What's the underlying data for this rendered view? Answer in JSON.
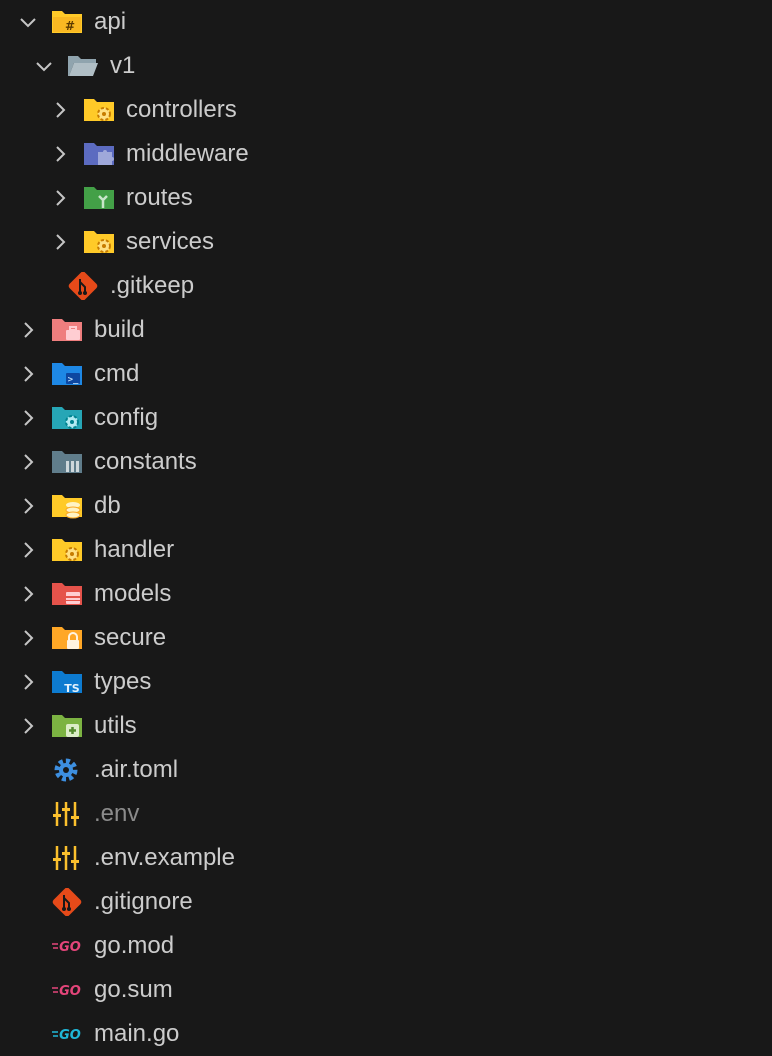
{
  "explorer": {
    "items": [
      {
        "label": "api",
        "icon": "folder-api-icon",
        "expanded": true
      },
      {
        "label": "v1",
        "icon": "folder-open-icon",
        "expanded": true
      },
      {
        "label": "controllers",
        "icon": "folder-controllers-icon",
        "expanded": false
      },
      {
        "label": "middleware",
        "icon": "folder-middleware-icon",
        "expanded": false
      },
      {
        "label": "routes",
        "icon": "folder-routes-icon",
        "expanded": false
      },
      {
        "label": "services",
        "icon": "folder-services-icon",
        "expanded": false
      },
      {
        "label": ".gitkeep",
        "icon": "git-icon"
      },
      {
        "label": "build",
        "icon": "folder-build-icon",
        "expanded": false
      },
      {
        "label": "cmd",
        "icon": "folder-cmd-icon",
        "expanded": false
      },
      {
        "label": "config",
        "icon": "folder-config-icon",
        "expanded": false
      },
      {
        "label": "constants",
        "icon": "folder-constants-icon",
        "expanded": false
      },
      {
        "label": "db",
        "icon": "folder-db-icon",
        "expanded": false
      },
      {
        "label": "handler",
        "icon": "folder-handler-icon",
        "expanded": false
      },
      {
        "label": "models",
        "icon": "folder-models-icon",
        "expanded": false
      },
      {
        "label": "secure",
        "icon": "folder-secure-icon",
        "expanded": false
      },
      {
        "label": "types",
        "icon": "folder-types-icon",
        "expanded": false,
        "badge": "TS"
      },
      {
        "label": "utils",
        "icon": "folder-utils-icon",
        "expanded": false
      },
      {
        "label": ".air.toml",
        "icon": "gear-icon"
      },
      {
        "label": ".env",
        "icon": "env-icon",
        "dimmed": true
      },
      {
        "label": ".env.example",
        "icon": "env-icon"
      },
      {
        "label": ".gitignore",
        "icon": "git-icon"
      },
      {
        "label": "go.mod",
        "icon": "go-mod-icon",
        "badge": "GO"
      },
      {
        "label": "go.sum",
        "icon": "go-mod-icon",
        "badge": "GO"
      },
      {
        "label": "main.go",
        "icon": "go-file-icon",
        "badge": "GO"
      }
    ]
  },
  "colors": {
    "background": "#181818",
    "text": "#cccccc",
    "dimmed_text": "#8b8b8b",
    "twisty": "#c5c5c5",
    "folder_yellow": "#ffca28",
    "folder_indigo": "#5c6bc0",
    "folder_green": "#43a047",
    "folder_pink": "#ef7e7e",
    "folder_blue": "#1e88e5",
    "folder_cyan": "#26a6b6",
    "folder_slate": "#607d8b",
    "folder_red": "#e5534b",
    "folder_orange": "#ffa726",
    "folder_types": "#0d7bd0",
    "folder_lime": "#7cb342",
    "git": "#e64a19",
    "gear": "#3d8fe0",
    "go_pink": "#e4457a",
    "go_cyan": "#20b7d7"
  }
}
